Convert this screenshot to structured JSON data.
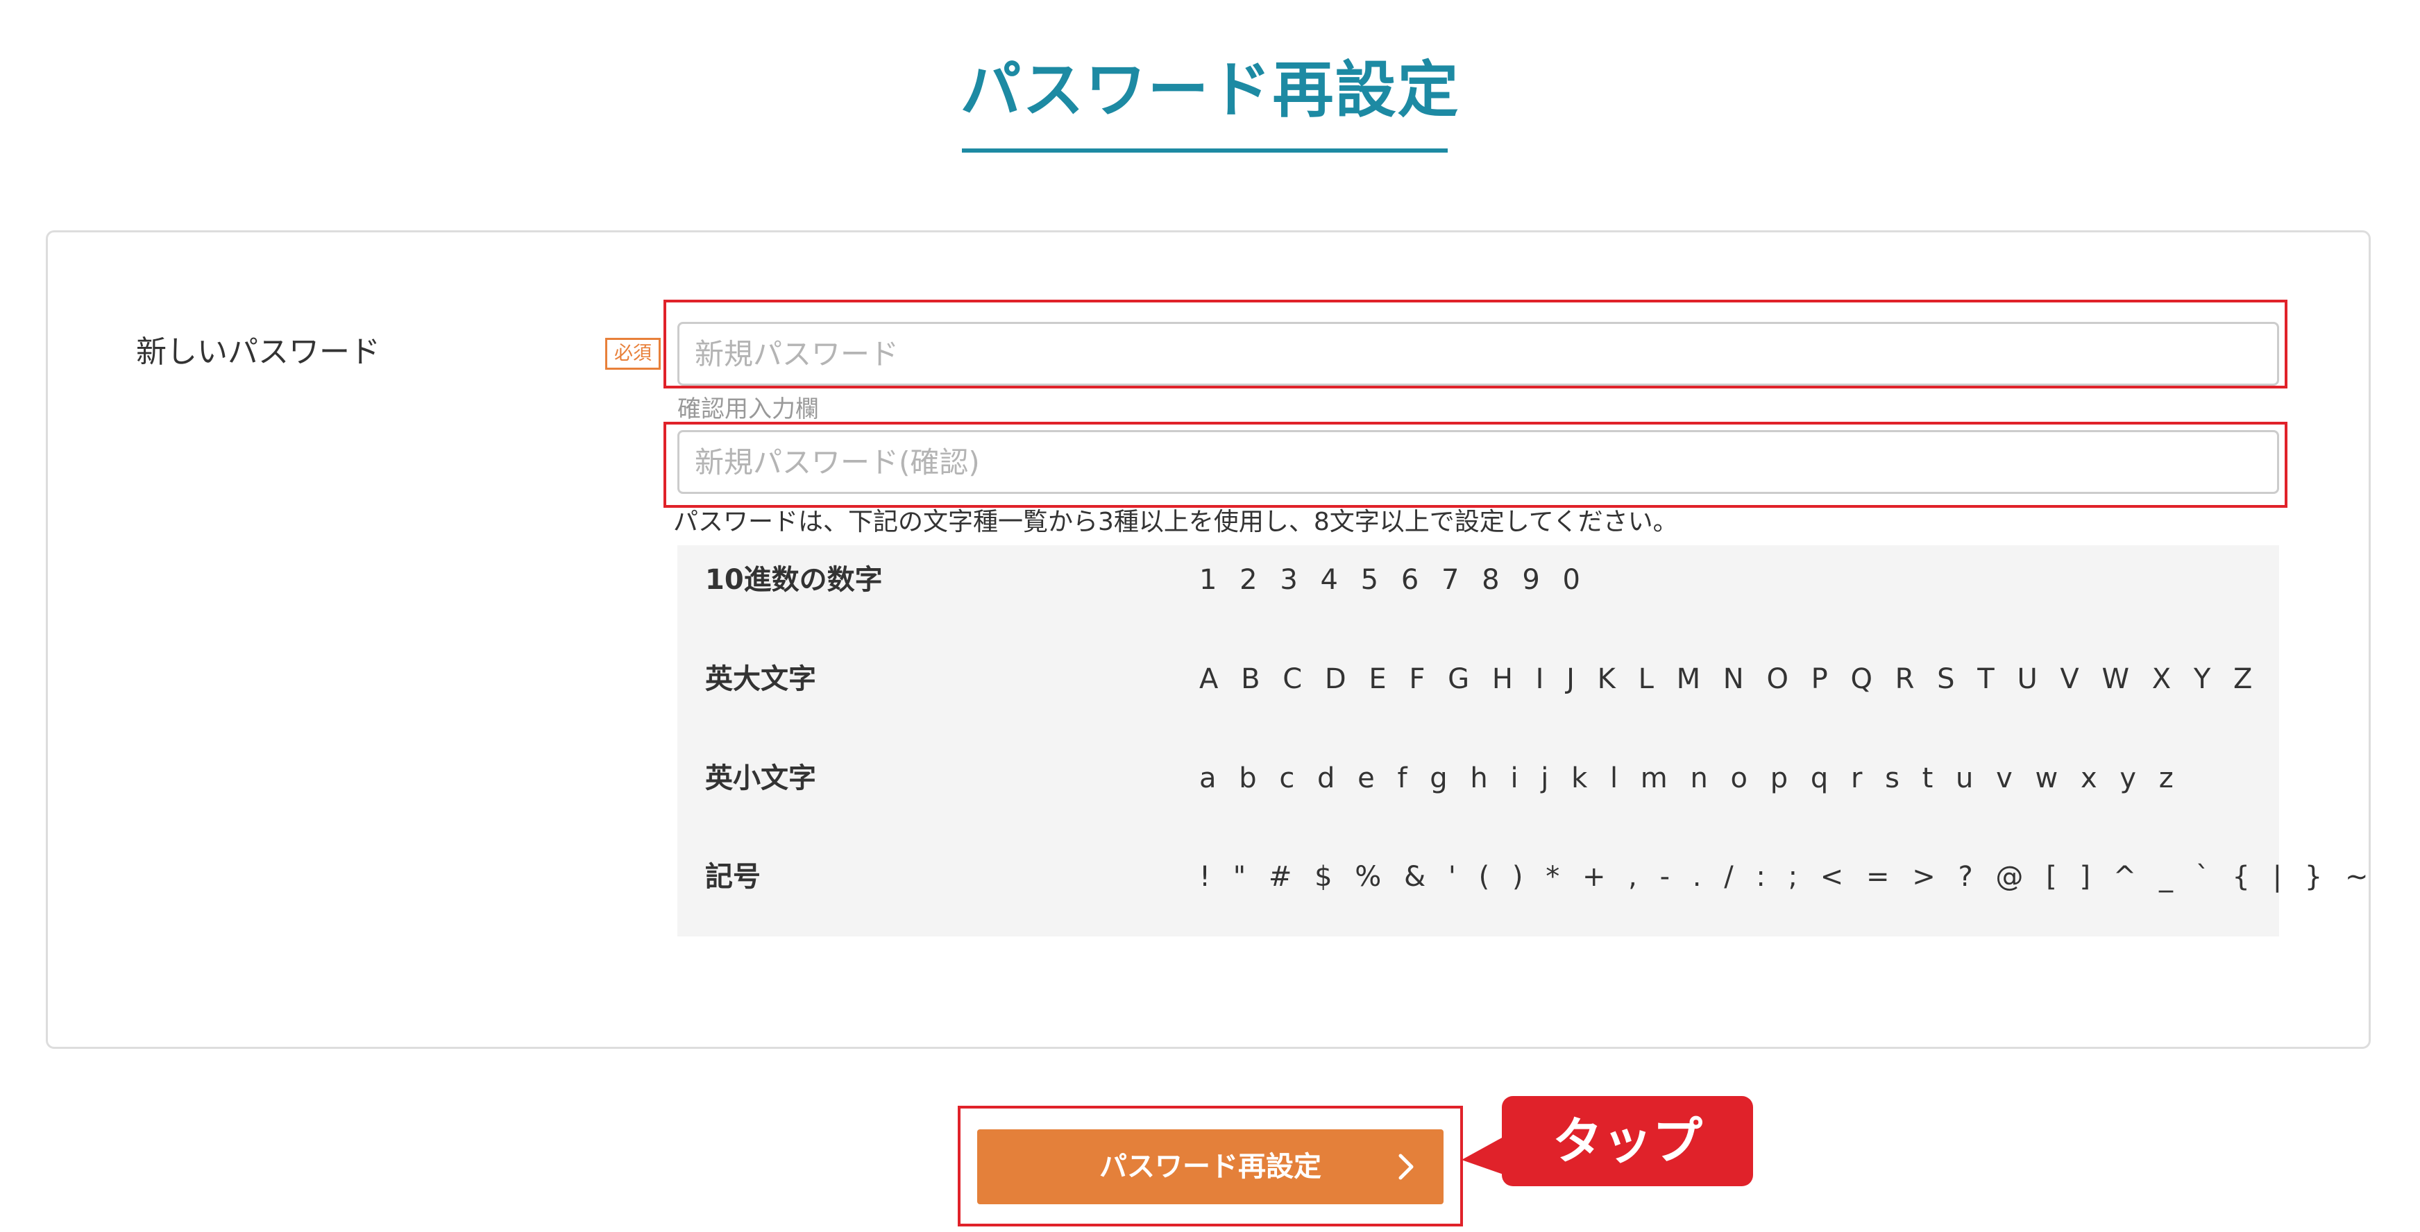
{
  "page": {
    "title": "パスワード再設定"
  },
  "form": {
    "field_label": "新しいパスワード",
    "required_badge": "必須",
    "new_password": {
      "value": "",
      "placeholder": "新規パスワード"
    },
    "confirm_caption": "確認用入力欄",
    "confirm_password": {
      "value": "",
      "placeholder": "新規パスワード(確認)"
    },
    "help_text": "パスワードは、下記の文字種一覧から3種以上を使用し、8文字以上で設定してください。",
    "char_types": [
      {
        "label": "10進数の数字",
        "chars": "1 2 3 4 5 6 7 8 9 0"
      },
      {
        "label": "英大文字",
        "chars": "A B C D E F G H I J K L M N O P Q R S T U V W X Y Z"
      },
      {
        "label": "英小文字",
        "chars": "a b c d e f g h i j k l m n o p q r s t u v w x y z"
      },
      {
        "label": "記号",
        "chars": "! \" # $ % & ' ( ) * + , - . / : ; < = > ? @ [ ] ^ _ ` { | } ~"
      }
    ]
  },
  "submit": {
    "label": "パスワード再設定",
    "icon": "chevron-right-icon"
  },
  "callout": {
    "label": "タップ"
  },
  "colors": {
    "accent": "#1d8aa3",
    "button": "#e4803a",
    "required": "#e8803a",
    "highlight": "#e0222a"
  }
}
